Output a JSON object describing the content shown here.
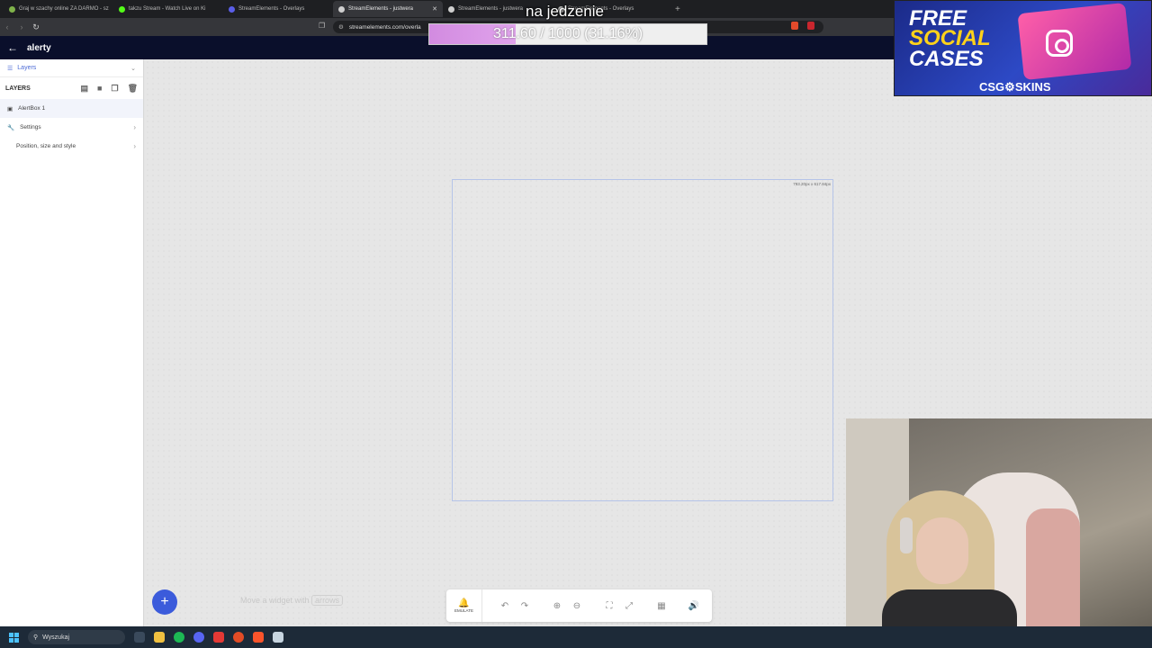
{
  "browser": {
    "tabs": [
      {
        "title": "Graj w szachy online ZA DARMO - sz",
        "active": false,
        "color": "#7fb24a"
      },
      {
        "title": "takzu Stream - Watch Live on Ki",
        "active": false,
        "color": "#53fc18"
      },
      {
        "title": "StreamElements - Overlays",
        "active": false,
        "color": "#5a5ee8"
      },
      {
        "title": "StreamElements - justwera",
        "active": true,
        "color": "#cfcfcf"
      },
      {
        "title": "StreamElements - justwera",
        "active": false,
        "color": "#cfcfcf"
      },
      {
        "title": "StreamElements - Overlays",
        "active": false,
        "color": "#cfcfcf"
      }
    ],
    "new_tab": "+",
    "url": "streamelements.com/overla"
  },
  "app": {
    "title": "alerty"
  },
  "sidebar": {
    "section_label": "Layers",
    "layers_heading": "LAYERS",
    "items": [
      {
        "label": "AlertBox 1",
        "icon": "alertbox-icon"
      },
      {
        "label": "Settings",
        "icon": "wrench-icon"
      },
      {
        "label": "Position, size and style",
        "icon": ""
      }
    ]
  },
  "canvas": {
    "widget_dims": "793.20px x 617.84px",
    "hint_prefix": "Move a widget with",
    "hint_key": "arrows",
    "toolbar": {
      "emulate_label": "EMULATE"
    }
  },
  "overlay": {
    "goal_title": "na jedzenie",
    "goal_text": "311.60 / 1000 (31.16%)",
    "goal_fraction": 0.3116,
    "ad_line1": "FREE",
    "ad_line2": "SOCIAL",
    "ad_line3": "CASES",
    "ad_brand": "CSG⚙SKINS"
  },
  "taskbar": {
    "search_label": "Wyszukaj"
  },
  "colors": {
    "accent": "#3b5bdb",
    "header_bg": "#0a0f2b",
    "goal_fill": "#d28be0"
  }
}
